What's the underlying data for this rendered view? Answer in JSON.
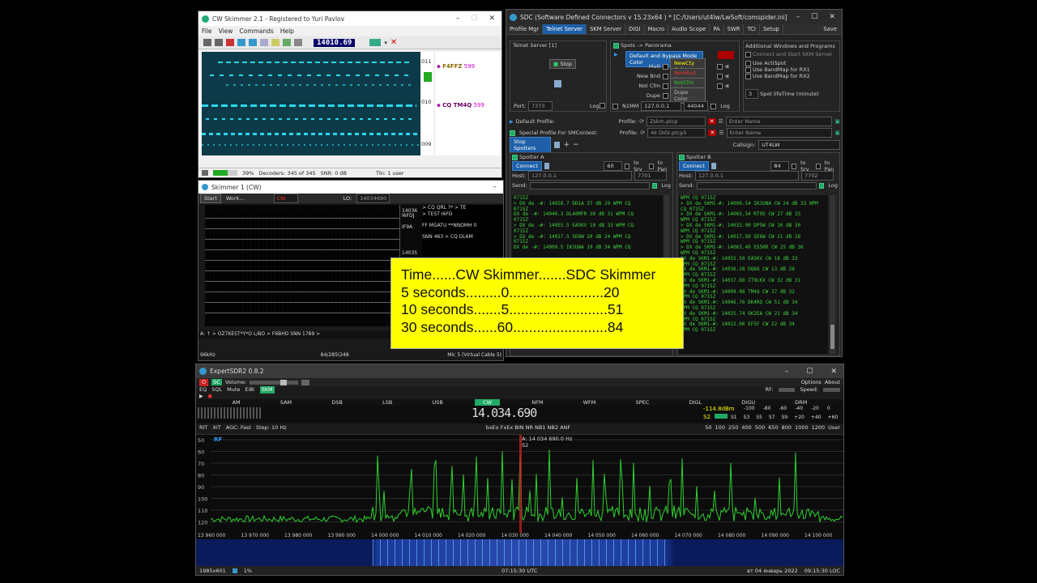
{
  "cw_skimmer": {
    "title": "CW Skimmer 2.1 - Registered to Yuri Pavlov",
    "menu": [
      "File",
      "View",
      "Commands",
      "Help"
    ],
    "freq": "14010.69",
    "freq_ticks": [
      "011",
      "010",
      "009"
    ],
    "spots": [
      {
        "call": "F4FFZ",
        "snr": "599"
      },
      {
        "call": "CQ TM4Q",
        "snr": "599"
      }
    ],
    "status": {
      "percent": "39%",
      "decoders": "Decoders: 345 of 345",
      "snr": "SNR: 0 dB",
      "tlnt": "Tln: 1 user"
    }
  },
  "skimmer1": {
    "title": "Skimmer 1 (CW)",
    "start": "Start",
    "work": "Work...",
    "mode": "CW",
    "lo_label": "LO:",
    "lo_value": "14034690",
    "freq_top": "14036",
    "freq_bottom": "14035",
    "calls": [
      "I6FDJ",
      "IF9A"
    ],
    "decodes": [
      " > CQ QRL ?* > TE",
      " > TEST I6FD ",
      "FF MGATU **NNOMH 0",
      "SNN 463 > CQ DL6M"
    ],
    "bottom_text": "A: ↑  > OZ7KEST*Y*O  L/BO  > F6BHD  SNN 1789 >",
    "status_left": "96kHz",
    "status_mid": "84/285(248",
    "status_right": "Mic 5 (Virtual Cable 5)"
  },
  "sdc": {
    "title": "SDC (Software Defined Connectors v 15.23x64 ) * [C:/Users/ut4lw/LwSoft/comspider.ini]",
    "tabs": [
      "Profile Mgr",
      "Telnet Server",
      "SKM Server",
      "DIGI",
      "Macro",
      "Audio Scope",
      "PA",
      "SWR",
      "TCI",
      "Setup"
    ],
    "save": "Save",
    "telnet_server_label": "Telnet Server [1]",
    "stop": "Stop",
    "port_label": "Port:",
    "port_value": "7373",
    "log_label": "Log",
    "spots_panorama": "Spots -> Panorama",
    "default_bypass": "Default and Bypass Mode Color",
    "color_rows": [
      {
        "label": "Mult",
        "btn": "NewCty Color"
      },
      {
        "label": "New Bnd",
        "btn": "NewBnd Color"
      },
      {
        "label": "Not Cfm",
        "btn": "NotCfm Color"
      },
      {
        "label": "Dupe",
        "btn": "Dupe Color"
      }
    ],
    "n1mm": "N1MM",
    "n1mm_ip": "127.0.0.1",
    "n1mm_port": "44044",
    "additional_title": "Additional Windows and Programs",
    "connect_skm": "Connect and Start SKM Server",
    "additional_items": [
      "Use ActiSpot",
      "Use BandMap for RX1",
      "Use BandMap for RX2"
    ],
    "spot_lifetime_value": "3",
    "spot_lifetime_label": "Spot lifeTime (minute)",
    "default_profile": "Default Profile:",
    "special_profile": "Special Profile For SMContest:",
    "profile_label": "Profile:",
    "profile1": "Zskm.ptcp",
    "profile2": "4k DIGI.ptcp5",
    "enter_name": "Enter Name",
    "stop_spotters": "Stop Spotters",
    "callsign_label": "Callsign:",
    "callsign": "UT4LW",
    "spotter_a": {
      "title": "Spotter A",
      "connect": "Connect",
      "num": "60",
      "to_srv": "to Srv",
      "to_pan": "to Pan",
      "host_label": "Host:",
      "host": "127.0.0.1",
      "port": "7701",
      "send": "Send:",
      "log": "Log",
      "lines": [
        "0715Z",
        "> DX de -#:    14028.7  DD1A     37 dB  29 WPM  CQ",
        "0715Z",
        "DX de -#:    14040.3  DL40MFR   38 dB  31 WPM  CQ",
        "0715Z",
        "> DX de -#:    14055.5  EA5KV    10 dB  33 WPM  CQ",
        "0715Z",
        "> DX de -#:    14017.5  SE6W     20 dB  24 WPM  CQ",
        "0715Z",
        "DX de -#:    14009.5  IK3UNA   19 dB  34 WPM  CQ"
      ]
    },
    "spotter_b": {
      "title": "Spotter B",
      "connect": "Connect",
      "num": "84",
      "to_srv": "to Srv",
      "to_pan": "to Pan",
      "host_label": "Host:",
      "host": "127.0.0.1",
      "port": "7702",
      "send": "Send:",
      "log": "Log",
      "lines": [
        "WPM  CQ      0715Z",
        "> DX de SKM1-#:  14009.54  IK3UNA     CW  24 dB 33 WPM",
        "CQ      0715Z",
        "> DX de SKM1-#:  14003.34  RT9S      CW  27 dB 33",
        "WPM  CQ      0715Z",
        "> DX de SKM1-#:  14033.00  DP5W      CW  10 dB 30",
        "WPM  CQ      0715Z",
        "> DX de SKM1-#:  14017.50  SE6W      CW  21 dB 28",
        "WPM  CQ      0715Z",
        "> DX de SKM1-#:  14063.40  ES5RR     CW  25 dB 36",
        "WPM  CQ      0715Z",
        "DX de SKM1-#:  14055.50  EA5KV     CW  18 dB 33",
        "WPM  CQ      0715Z",
        "DX de SKM1-#:  14036.28  DQ6Q      CW  13 dB 28",
        "WPM  CQ      0715Z",
        "DX de SKM1-#:  14037.88  IT9LKX    CW  32 dB 31",
        "WPM  CQ      0715Z",
        "DX de SKM1-#:  14009.98  TM4Q      CW  37 dB 32",
        "WPM  CQ      0715Z",
        "DX de SKM1-#:  14046.76  DK4RQ     CW  51 dB 34",
        "WPM  CQ      0715Z",
        "DX de SKM1-#:  14025.74  OK2EA     CW  21 dB 34",
        "WPM  CQ      0715Z",
        "DX de SKM1-#:  14022.00  EF5F      CW  22 dB 34",
        "WPM  CQ      0715Z"
      ]
    }
  },
  "overlay": {
    "lines": [
      "Time......CW Skimmer.......SDC Skimmer",
      "5 seconds.........0........................20",
      "10 seconds.......5.........................51",
      "30 seconds......60........................84"
    ]
  },
  "expert": {
    "title": "ExpertSDR2 0.8.2",
    "options": "Options",
    "about": "About",
    "volume": "Volume:",
    "toggles": [
      "EQ",
      "SQL",
      "Mute",
      "EiBi",
      "SKM"
    ],
    "rf_label": "RF:",
    "speed_label": "Speed:",
    "modes": [
      "AM",
      "SAM",
      "DSB",
      "LSB",
      "USB",
      "CW",
      "NFM",
      "WFM",
      "SPEC",
      "DIGL",
      "DIGU",
      "DRM"
    ],
    "active_mode": "CW",
    "freq_display": "14.034.690",
    "level": "-114.8dBm",
    "s_label": "S2",
    "s_scale": [
      "S1",
      "S3",
      "S5",
      "S7",
      "S9",
      "+20",
      "+40",
      "+60",
      "+80"
    ],
    "db_scale": [
      "-100",
      "-80",
      "-60",
      "-40",
      "-20",
      "0"
    ],
    "bw_scale": [
      "50",
      "100",
      "250",
      "400",
      "500",
      "650",
      "800",
      "1000",
      "1200",
      "User"
    ],
    "rit": "RIT",
    "xit": "XIT",
    "agc": "AGC: Fast",
    "step": "Step: 10 Hz",
    "dsp": "bxEx FxEx BIN  NR  NB1 NB2 ANF",
    "rf_tag": "RF",
    "cursor_freq": "A: 14 034 690.0 Hz",
    "cursor_s": "S2",
    "y_ticks": [
      "50",
      "60",
      "70",
      "80",
      "90",
      "100",
      "110",
      "120"
    ],
    "x_ticks": [
      "13 960 000",
      "13 970 000",
      "13 980 000",
      "13 990 000",
      "14 000 000",
      "14 010 000",
      "14 020 000",
      "14 030 000",
      "14 040 000",
      "14 050 000",
      "14 060 000",
      "14 070 000",
      "14 080 000",
      "14 090 000",
      "14 100 000",
      "14 110 00"
    ],
    "status_left": "1985x601",
    "status_pct": "1%",
    "status_mid": "07:15:30 UTC",
    "status_date": "вт 04 январь 2022",
    "status_right": "09:15:30 LOC"
  }
}
